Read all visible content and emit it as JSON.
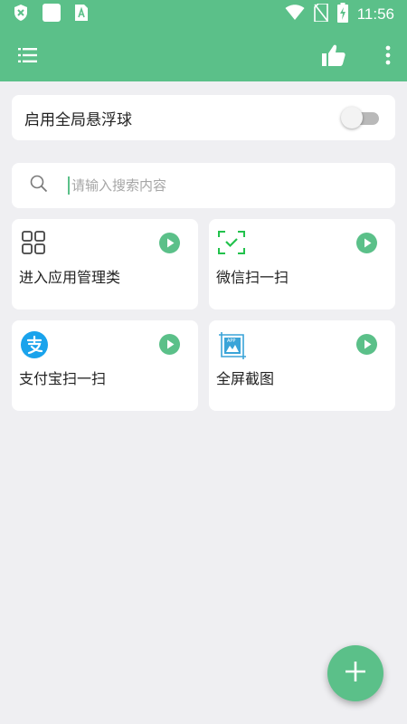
{
  "status_bar": {
    "time": "11:56",
    "icons": [
      "shield-x-icon",
      "notification-square-icon",
      "font-a-icon",
      "wifi-icon",
      "no-sim-icon",
      "battery-charging-icon"
    ]
  },
  "app_bar": {
    "menu_icon": "list-icon",
    "like_icon": "thumbs-up-icon",
    "more_icon": "more-vert-icon"
  },
  "floating_ball": {
    "label": "启用全局悬浮球",
    "enabled": false
  },
  "search": {
    "placeholder": "请输入搜索内容",
    "value": ""
  },
  "shortcuts": [
    {
      "label": "进入应用管理类",
      "icon": "grid-apps-icon"
    },
    {
      "label": "微信扫一扫",
      "icon": "scan-check-icon"
    },
    {
      "label": "支付宝扫一扫",
      "icon": "alipay-icon"
    },
    {
      "label": "全屏截图",
      "icon": "screenshot-app-icon"
    }
  ],
  "fab": {
    "icon": "plus-icon"
  },
  "colors": {
    "accent": "#5bc089",
    "background": "#efeff2",
    "alipay": "#1aa3ec",
    "scan": "#22c24c",
    "screenshot": "#3aa4d8"
  }
}
